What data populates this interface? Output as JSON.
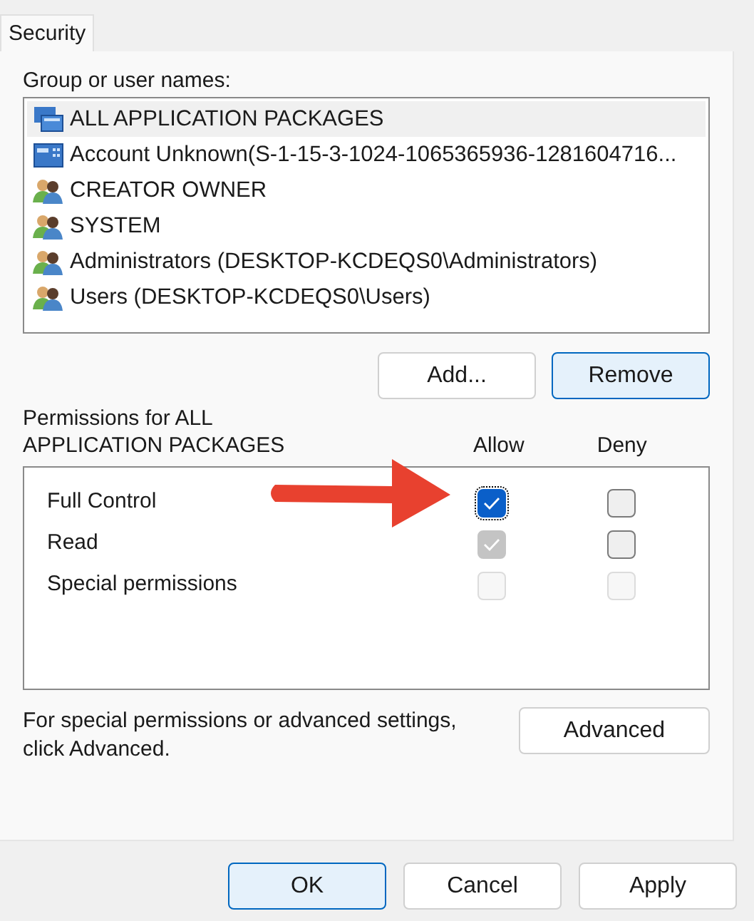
{
  "tabs": [
    {
      "label": "Security",
      "selected": true
    }
  ],
  "group_list": {
    "label": "Group or user names:",
    "items": [
      {
        "name": "ALL APPLICATION PACKAGES",
        "kind": "package",
        "selected": true
      },
      {
        "name": "Account Unknown(S-1-15-3-1024-1065365936-1281604716...",
        "kind": "account",
        "selected": false
      },
      {
        "name": "CREATOR OWNER",
        "kind": "group",
        "selected": false
      },
      {
        "name": "SYSTEM",
        "kind": "group",
        "selected": false
      },
      {
        "name": "Administrators (DESKTOP-KCDEQS0\\Administrators)",
        "kind": "group",
        "selected": false
      },
      {
        "name": "Users (DESKTOP-KCDEQS0\\Users)",
        "kind": "group",
        "selected": false
      }
    ]
  },
  "list_buttons": [
    {
      "label": "Add...",
      "focused": false
    },
    {
      "label": "Remove",
      "focused": true
    }
  ],
  "permissions": {
    "label": "Permissions for ALL APPLICATION PACKAGES",
    "allow_header": "Allow",
    "deny_header": "Deny",
    "rows": [
      {
        "name": "Full Control",
        "allow": {
          "checked": true,
          "disabled": false
        },
        "deny": {
          "checked": false,
          "disabled": false
        }
      },
      {
        "name": "Read",
        "allow": {
          "checked": true,
          "disabled": true
        },
        "deny": {
          "checked": false,
          "disabled": false
        }
      },
      {
        "name": "Special permissions",
        "allow": {
          "checked": false,
          "disabled": true
        },
        "deny": {
          "checked": false,
          "disabled": true
        }
      }
    ]
  },
  "advanced": {
    "text": "For special permissions or advanced settings, click Advanced.",
    "button": "Advanced"
  },
  "annotation": {
    "kind": "arrow"
  },
  "dialog_buttons": [
    {
      "label": "OK",
      "focused": true
    },
    {
      "label": "Cancel",
      "focused": false
    },
    {
      "label": "Apply",
      "focused": false
    }
  ]
}
